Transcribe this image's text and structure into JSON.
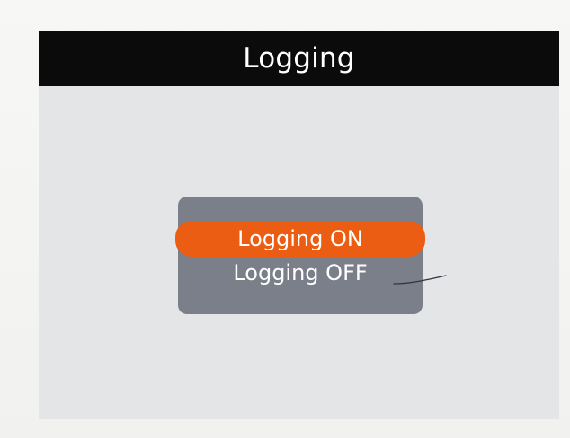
{
  "screen": {
    "title": "Logging"
  },
  "menu": {
    "items": [
      {
        "label": "Logging ON",
        "selected": true
      },
      {
        "label": "Logging OFF",
        "selected": false
      }
    ]
  },
  "colors": {
    "title_bar": "#0b0b0b",
    "screen_background": "#e4e5e6",
    "menu_background": "#7b7f8a",
    "selected_item": "#ea5d12",
    "text": "#ffffff"
  }
}
